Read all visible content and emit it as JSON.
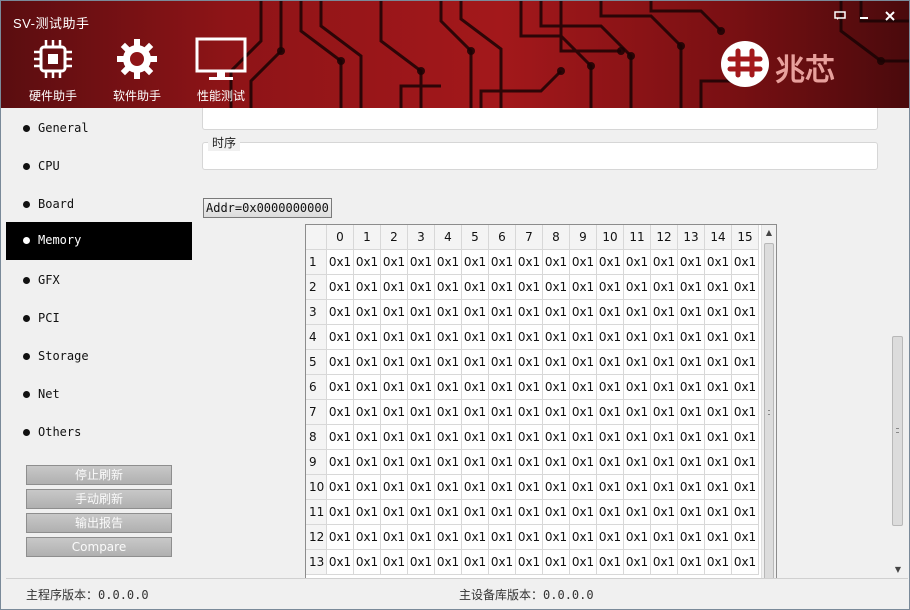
{
  "app": {
    "title": "SV-测试助手",
    "window_controls": {
      "help": "▀",
      "minimize": "—",
      "close": "✕"
    }
  },
  "nav": [
    {
      "label": "硬件助手",
      "icon": "chip-icon"
    },
    {
      "label": "软件助手",
      "icon": "gear-icon"
    },
    {
      "label": "性能测试",
      "icon": "monitor-icon"
    }
  ],
  "brand": {
    "logo_text": "兆芯",
    "logo_mark": "zhaoxin-logo-icon",
    "accent": "#a3181b"
  },
  "sidebar": {
    "items": [
      "General",
      "CPU",
      "Board",
      "Memory",
      "GFX",
      "PCI",
      "Storage",
      "Net",
      "Others"
    ],
    "active": "Memory",
    "buttons": [
      "停止刷新",
      "手动刷新",
      "输出报告",
      "Compare"
    ]
  },
  "main": {
    "timing_title": "时序",
    "addr_button": "Addr=0x0000000000",
    "table": {
      "columns": [
        "0",
        "1",
        "2",
        "3",
        "4",
        "5",
        "6",
        "7",
        "8",
        "9",
        "10",
        "11",
        "12",
        "13",
        "14",
        "15"
      ],
      "rows": [
        "1",
        "2",
        "3",
        "4",
        "5",
        "6",
        "7",
        "8",
        "9",
        "10",
        "11",
        "12",
        "13"
      ],
      "cell_value": "0x1"
    }
  },
  "status": {
    "main_label": "主程序版本：",
    "main_version": "0.0.0.0",
    "lib_label": "主设备库版本：",
    "lib_version": "0.0.0.0"
  }
}
